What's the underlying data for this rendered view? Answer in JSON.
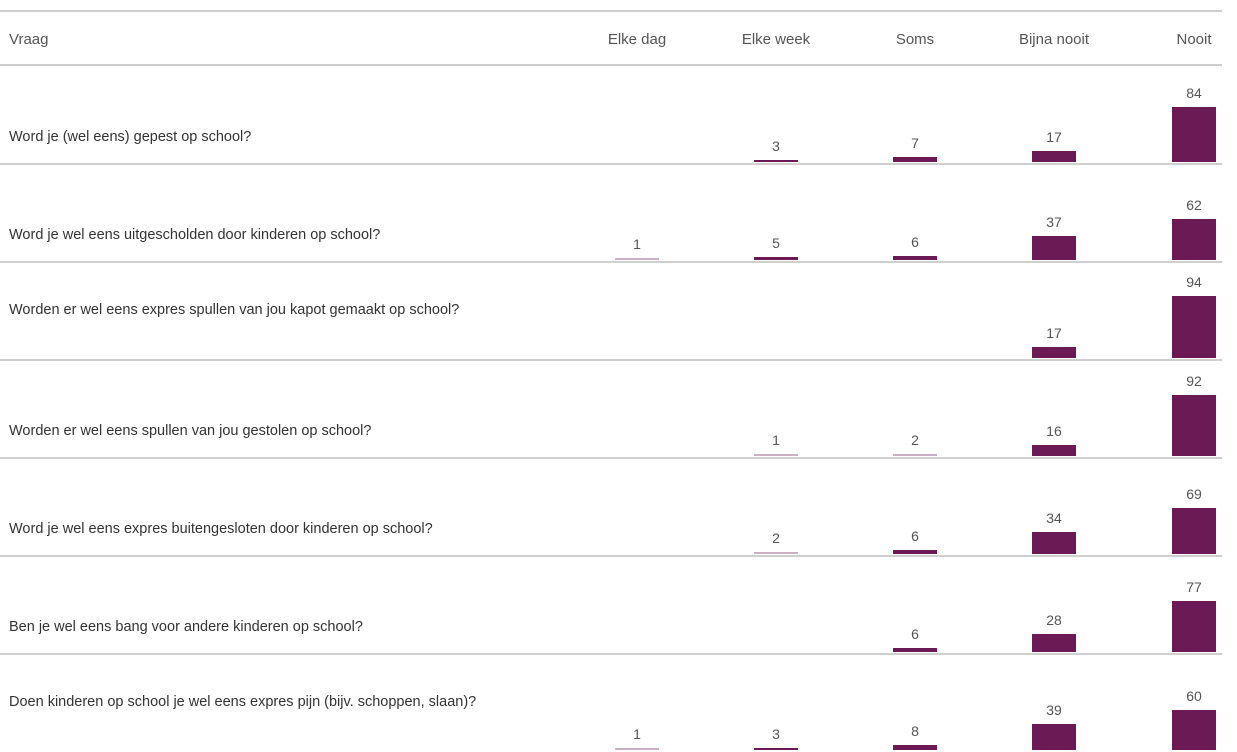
{
  "chart_data": {
    "type": "table",
    "columns": [
      "Vraag",
      "Elke dag",
      "Elke week",
      "Soms",
      "Bijna nooit",
      "Nooit"
    ],
    "bar_color": "#6b1a56",
    "rows": [
      {
        "question": "Word je (wel eens) gepest op school?",
        "values": [
          null,
          3,
          7,
          17,
          84
        ]
      },
      {
        "question": "Word je wel eens uitgescholden door kinderen op school?",
        "values": [
          1,
          5,
          6,
          37,
          62
        ]
      },
      {
        "question": "Worden er wel eens expres spullen van jou kapot gemaakt op school?",
        "values": [
          null,
          null,
          null,
          17,
          94
        ]
      },
      {
        "question": "Worden er wel eens spullen van jou gestolen op school?",
        "values": [
          null,
          1,
          2,
          16,
          92
        ]
      },
      {
        "question": "Word je wel eens expres buitengesloten door kinderen op school?",
        "values": [
          null,
          2,
          6,
          34,
          69
        ]
      },
      {
        "question": "Ben je wel eens bang voor andere kinderen op school?",
        "values": [
          null,
          null,
          6,
          28,
          77
        ]
      },
      {
        "question": "Doen kinderen op school je wel eens expres pijn (bijv. schoppen, slaan)?",
        "values": [
          1,
          3,
          8,
          39,
          60
        ]
      }
    ]
  }
}
